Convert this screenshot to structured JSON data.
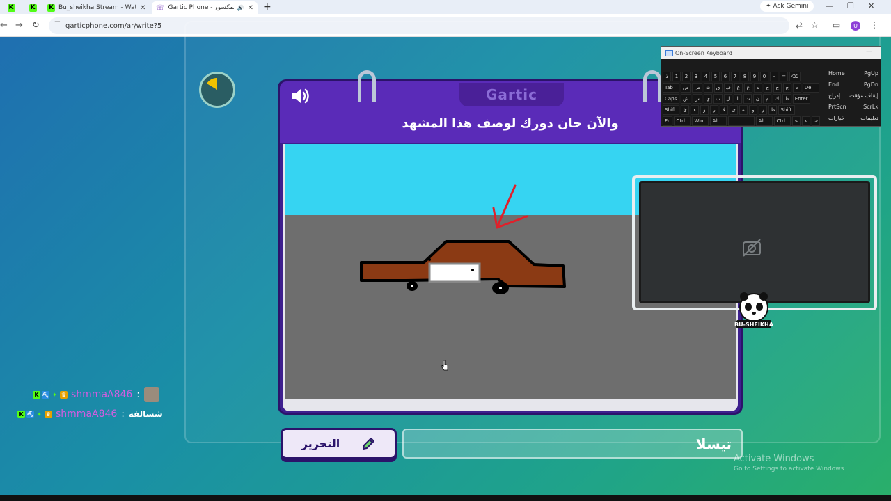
{
  "browser": {
    "tabs": [
      {
        "title": "",
        "icon": "kick-icon",
        "active": false
      },
      {
        "title": "",
        "icon": "kick-icon",
        "active": false
      },
      {
        "title": "Bu_sheikha Stream - Watch Live",
        "icon": "kick-icon",
        "active": false
      },
      {
        "title": "Gartic Phone - هاتف المكسور",
        "icon": "gartic-icon",
        "active": true
      }
    ],
    "gemini_label": "Ask Gemini",
    "url": "garticphone.com/ar/write?5",
    "avatar_letter": "U"
  },
  "game": {
    "logo": "Gartic",
    "prompt": "والآن حان دورك لوصف هذا المشهد",
    "answer_value": "تيسلا",
    "edit_label": "التحرير",
    "colors": {
      "sky": "#36d4f2",
      "ground": "#6e6e6e",
      "car": "#8b3a14",
      "arrow": "#e0202a",
      "card": "#3d1f8e",
      "header": "#5a2bb8"
    }
  },
  "osk": {
    "title": "On-Screen Keyboard",
    "rows": [
      [
        "ذ",
        "1",
        "2",
        "3",
        "4",
        "5",
        "6",
        "7",
        "8",
        "9",
        "0",
        "-",
        "=",
        "⌫"
      ],
      [
        "Tab",
        "ض",
        "ص",
        "ث",
        "ق",
        "ف",
        "غ",
        "ع",
        "ه",
        "خ",
        "ح",
        "ج",
        "د",
        "Del"
      ],
      [
        "Caps",
        "ش",
        "س",
        "ي",
        "ب",
        "ل",
        "ا",
        "ت",
        "ن",
        "م",
        "ك",
        "ط",
        "Enter"
      ],
      [
        "Shift",
        "ئ",
        "ء",
        "ؤ",
        "ر",
        "لا",
        "ى",
        "ة",
        "و",
        "ز",
        "ظ",
        "Shift"
      ],
      [
        "Fn",
        "Ctrl",
        "Win",
        "Alt",
        "",
        "Alt",
        "Ctrl",
        "<",
        "v",
        ">"
      ]
    ],
    "side": [
      [
        "Home",
        "PgUp"
      ],
      [
        "End",
        "PgDn"
      ],
      [
        "إدراج",
        "إيقاف مؤقت"
      ],
      [
        "PrtScn",
        "ScrLk"
      ],
      [
        "خيارات",
        "تعليمات"
      ]
    ]
  },
  "chat": [
    {
      "user": "shmmaA846",
      "message": "",
      "emote": true
    },
    {
      "user": "shmmaA846",
      "message": "شسالفه",
      "emote": false
    }
  ],
  "cam": {
    "brand": "BU-SHEIKHA"
  },
  "watermark": {
    "line1": "Activate Windows",
    "line2": "Go to Settings to activate Windows"
  }
}
